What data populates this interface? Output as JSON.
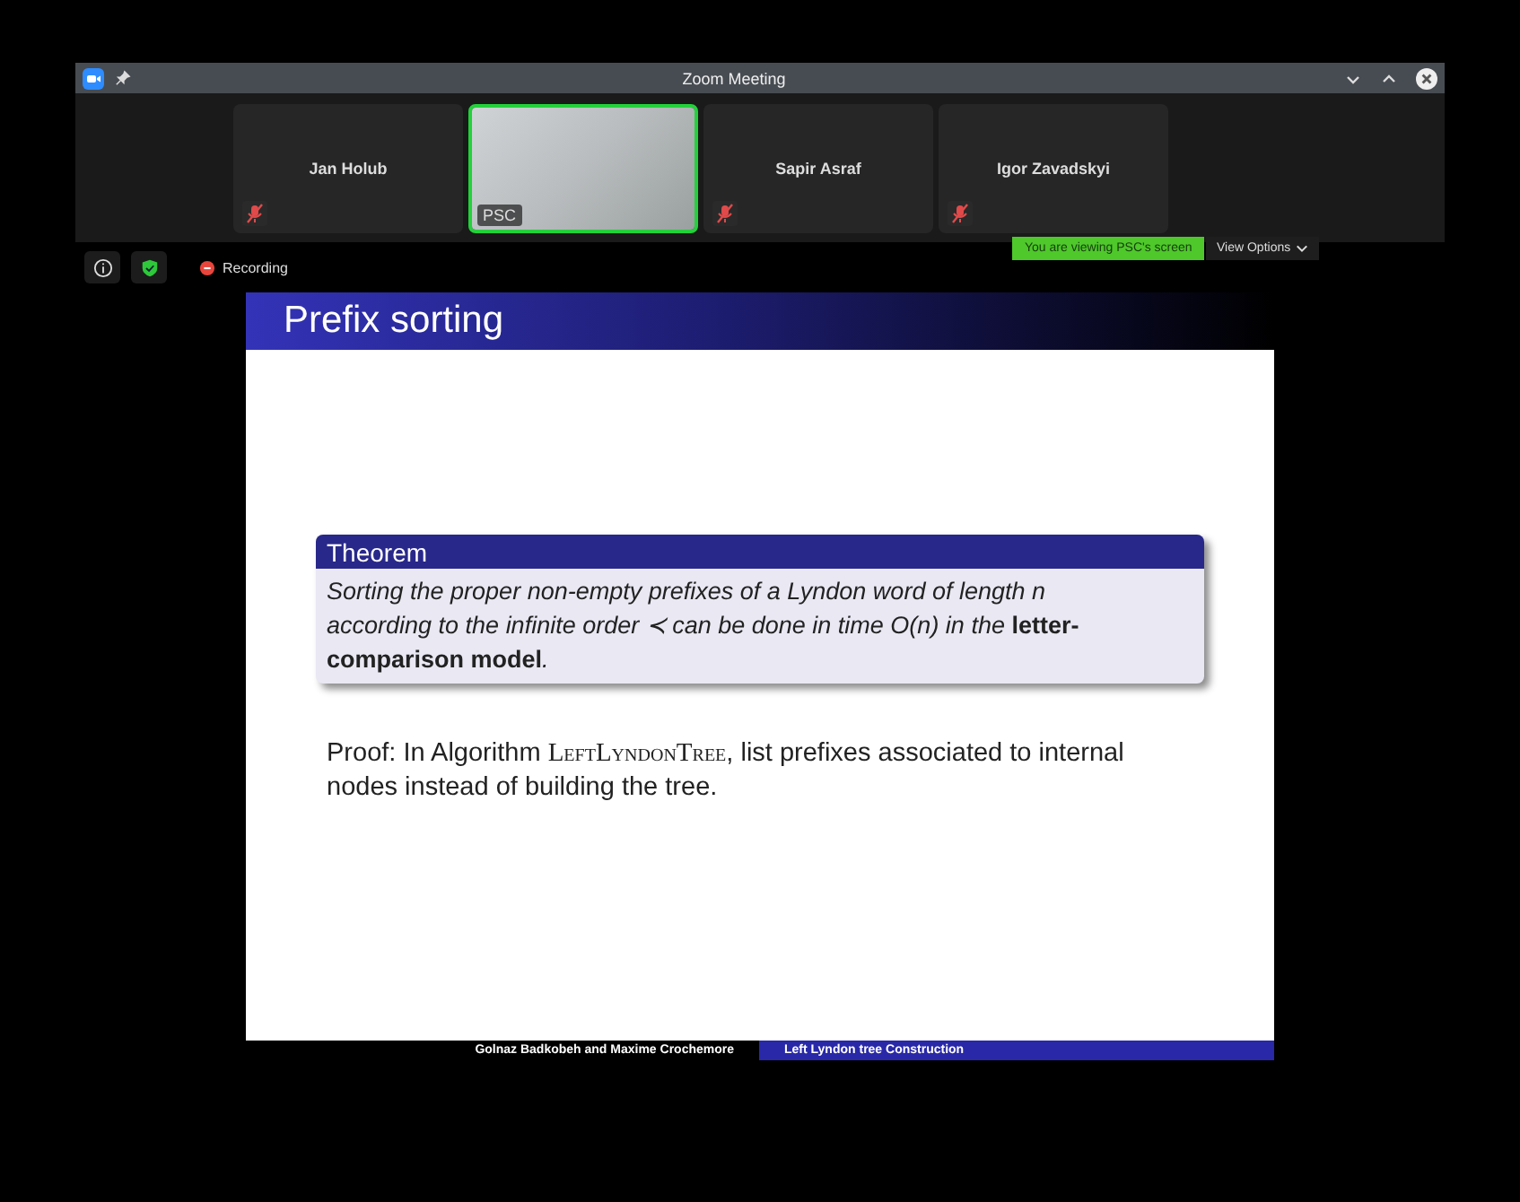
{
  "window": {
    "title": "Zoom Meeting"
  },
  "participants": [
    {
      "name": "Jan Holub",
      "kind": "avatar",
      "muted": true,
      "selected": false
    },
    {
      "name": "PSC",
      "kind": "video",
      "muted": false,
      "selected": true
    },
    {
      "name": "Sapir Asraf",
      "kind": "avatar",
      "muted": true,
      "selected": false
    },
    {
      "name": "Igor Zavadskyi",
      "kind": "avatar",
      "muted": true,
      "selected": false
    }
  ],
  "recording": {
    "label": "Recording"
  },
  "share_banner": {
    "text": "You are viewing PSC's screen",
    "view_options": "View Options"
  },
  "slide": {
    "title": "Prefix sorting",
    "theorem": {
      "heading": "Theorem",
      "text": "Sorting the proper non-empty prefixes of a Lyndon word of length n according to the infinite order ≺ can be done in time O(n) in the **letter-comparison model**."
    },
    "proof": {
      "before": "Proof: In Algorithm ",
      "algorithm": "LeftLyndonTree",
      "after": ", list prefixes associated to internal nodes instead of building the tree."
    },
    "footer": {
      "authors": "Golnaz Badkobeh and Maxime Crochemore",
      "talk_title": "Left Lyndon tree Construction"
    }
  }
}
